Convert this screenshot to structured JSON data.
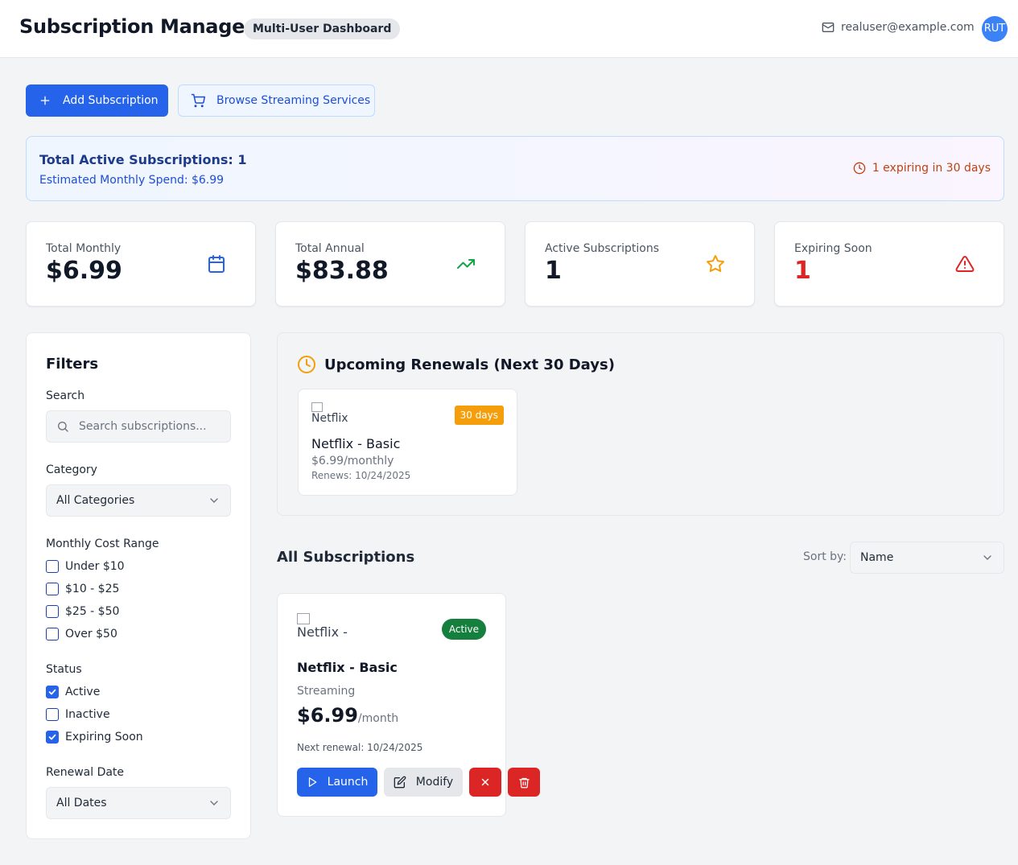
{
  "header": {
    "title": "Subscription Manager",
    "badge": "Multi-User Dashboard",
    "email": "realuser@example.com",
    "avatar_initials": "RUT"
  },
  "actions": {
    "add_label": "Add Subscription",
    "browse_label": "Browse Streaming Services"
  },
  "summary": {
    "total_active": "Total Active Subscriptions: 1",
    "monthly_spend": "Estimated Monthly Spend: $6.99",
    "expiring": "1 expiring in 30 days"
  },
  "stats": [
    {
      "label": "Total Monthly",
      "value": "$6.99",
      "icon": "calendar-icon",
      "color": "#2563eb"
    },
    {
      "label": "Total Annual",
      "value": "$83.88",
      "icon": "trending-up-icon",
      "color": "#16a34a"
    },
    {
      "label": "Active Subscriptions",
      "value": "1",
      "icon": "star-icon",
      "color": "#f59e0b"
    },
    {
      "label": "Expiring Soon",
      "value": "1",
      "icon": "alert-triangle-icon",
      "color": "#dc2626"
    }
  ],
  "filters": {
    "title": "Filters",
    "search_label": "Search",
    "search_placeholder": "Search subscriptions...",
    "category_label": "Category",
    "category_value": "All Categories",
    "cost_label": "Monthly Cost Range",
    "cost_options": [
      {
        "label": "Under $10",
        "checked": false
      },
      {
        "label": "$10 - $25",
        "checked": false
      },
      {
        "label": "$25 - $50",
        "checked": false
      },
      {
        "label": "Over $50",
        "checked": false
      }
    ],
    "status_label": "Status",
    "status_options": [
      {
        "label": "Active",
        "checked": true
      },
      {
        "label": "Inactive",
        "checked": false
      },
      {
        "label": "Expiring Soon",
        "checked": true
      }
    ],
    "renewal_label": "Renewal Date",
    "renewal_value": "All Dates"
  },
  "renewals": {
    "title": "Upcoming Renewals (Next 30 Days)",
    "items": [
      {
        "image_alt": "Netflix",
        "badge": "30 days",
        "name": "Netflix - Basic",
        "price": "$6.99/monthly",
        "renews": "Renews: 10/24/2025"
      }
    ]
  },
  "subscriptions": {
    "title": "All Subscriptions",
    "sort_label": "Sort by:",
    "sort_value": "Name",
    "items": [
      {
        "image_alt": "Netflix -",
        "status": "Active",
        "name": "Netflix - Basic",
        "category": "Streaming",
        "price": "$6.99",
        "period": "/month",
        "next_renewal": "Next renewal: 10/24/2025",
        "launch_label": "Launch",
        "modify_label": "Modify"
      }
    ]
  },
  "colors": {
    "primary": "#2563eb",
    "success": "#15803d",
    "warning": "#f59e0b",
    "danger": "#dc2626"
  }
}
